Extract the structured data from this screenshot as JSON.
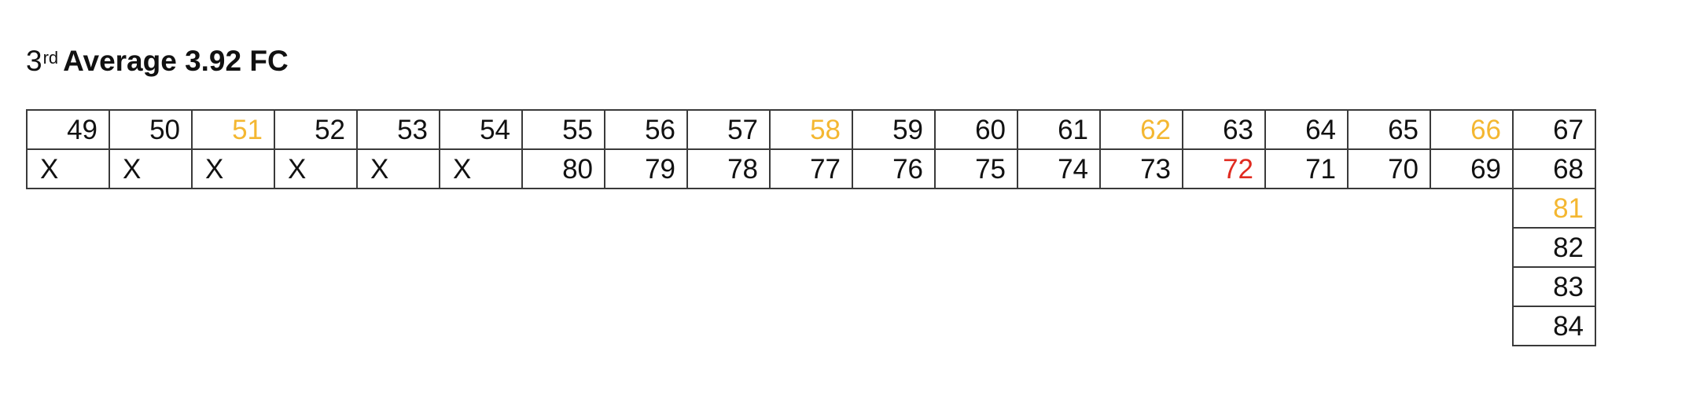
{
  "heading": {
    "ordinal": "3",
    "ordinal_suffix": "rd",
    "text": "Average 3.92 FC"
  },
  "colors": {
    "default": "#111111",
    "highlight": "#f4b731",
    "alert": "#e02b20",
    "border": "#3a3a3a"
  },
  "grid": {
    "top_row": [
      {
        "text": "49",
        "status": "default"
      },
      {
        "text": "50",
        "status": "default"
      },
      {
        "text": "51",
        "status": "highlight"
      },
      {
        "text": "52",
        "status": "default"
      },
      {
        "text": "53",
        "status": "default"
      },
      {
        "text": "54",
        "status": "default"
      },
      {
        "text": "55",
        "status": "default"
      },
      {
        "text": "56",
        "status": "default"
      },
      {
        "text": "57",
        "status": "default"
      },
      {
        "text": "58",
        "status": "highlight"
      },
      {
        "text": "59",
        "status": "default"
      },
      {
        "text": "60",
        "status": "default"
      },
      {
        "text": "61",
        "status": "default"
      },
      {
        "text": "62",
        "status": "highlight"
      },
      {
        "text": "63",
        "status": "default"
      },
      {
        "text": "64",
        "status": "default"
      },
      {
        "text": "65",
        "status": "default"
      },
      {
        "text": "66",
        "status": "highlight"
      },
      {
        "text": "67",
        "status": "default"
      }
    ],
    "bottom_row": [
      {
        "text": "X",
        "status": "default"
      },
      {
        "text": "X",
        "status": "default"
      },
      {
        "text": "X",
        "status": "default"
      },
      {
        "text": "X",
        "status": "default"
      },
      {
        "text": "X",
        "status": "default"
      },
      {
        "text": "X",
        "status": "default"
      },
      {
        "text": "80",
        "status": "default"
      },
      {
        "text": "79",
        "status": "default"
      },
      {
        "text": "78",
        "status": "default"
      },
      {
        "text": "77",
        "status": "default"
      },
      {
        "text": "76",
        "status": "default"
      },
      {
        "text": "75",
        "status": "default"
      },
      {
        "text": "74",
        "status": "default"
      },
      {
        "text": "73",
        "status": "default"
      },
      {
        "text": "72",
        "status": "alert"
      },
      {
        "text": "71",
        "status": "default"
      },
      {
        "text": "70",
        "status": "default"
      },
      {
        "text": "69",
        "status": "default"
      },
      {
        "text": "68",
        "status": "default"
      }
    ],
    "last_column_extension": [
      {
        "text": "81",
        "status": "highlight"
      },
      {
        "text": "82",
        "status": "default"
      },
      {
        "text": "83",
        "status": "default"
      },
      {
        "text": "84",
        "status": "default"
      }
    ]
  }
}
